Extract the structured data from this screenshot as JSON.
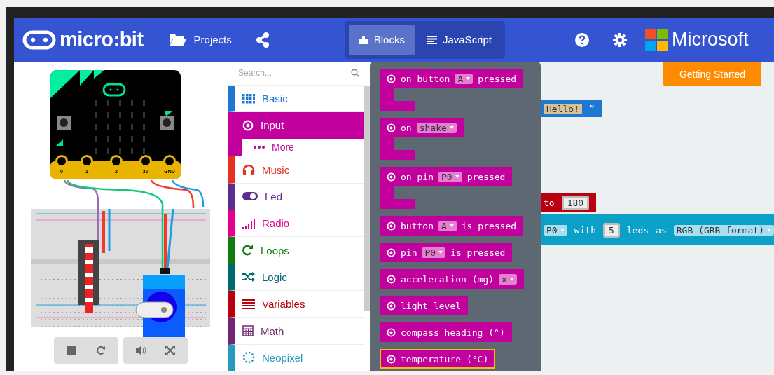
{
  "header": {
    "logo": "micro:bit",
    "projects": "Projects",
    "editor_tabs": [
      {
        "label": "Blocks",
        "selected": true
      },
      {
        "label": "JavaScript",
        "selected": false
      }
    ],
    "brand": "Microsoft"
  },
  "simulator": {
    "pin_labels": [
      "0",
      "1",
      "2",
      "3V",
      "GND"
    ]
  },
  "toolbox": {
    "search": {
      "placeholder": "Search..."
    },
    "categories": [
      {
        "label": "Basic",
        "kind": "category",
        "color": "#1e78d2",
        "selected": false
      },
      {
        "label": "Input",
        "kind": "category",
        "color": "#c2009e",
        "selected": true
      },
      {
        "label": "More",
        "kind": "more",
        "color": "#c2009e",
        "selected": false
      },
      {
        "label": "Music",
        "kind": "category",
        "color": "#e63022",
        "selected": false
      },
      {
        "label": "Led",
        "kind": "category",
        "color": "#5c2d91",
        "selected": false
      },
      {
        "label": "Radio",
        "kind": "category",
        "color": "#e3008c",
        "selected": false
      },
      {
        "label": "Loops",
        "kind": "category",
        "color": "#107c10",
        "selected": false
      },
      {
        "label": "Logic",
        "kind": "category",
        "color": "#006970",
        "selected": false
      },
      {
        "label": "Variables",
        "kind": "category",
        "color": "#b8000e",
        "selected": false
      },
      {
        "label": "Math",
        "kind": "category",
        "color": "#712672",
        "selected": false
      },
      {
        "label": "Neopixel",
        "kind": "category",
        "color": "#2699bf",
        "selected": false
      }
    ]
  },
  "flyout": {
    "blocks": [
      {
        "kind": "event",
        "selected": false,
        "parts": [
          {
            "kind": "text",
            "text": "on button"
          },
          {
            "kind": "dropdown",
            "text": "A"
          },
          {
            "kind": "text",
            "text": "pressed"
          }
        ]
      },
      {
        "kind": "event",
        "selected": false,
        "parts": [
          {
            "kind": "text",
            "text": "on"
          },
          {
            "kind": "dropdown",
            "text": "shake"
          }
        ]
      },
      {
        "kind": "event",
        "selected": false,
        "parts": [
          {
            "kind": "text",
            "text": "on pin"
          },
          {
            "kind": "dropdown",
            "text": "P0"
          },
          {
            "kind": "text",
            "text": "pressed"
          }
        ]
      },
      {
        "kind": "reporter",
        "selected": false,
        "parts": [
          {
            "kind": "text",
            "text": "button"
          },
          {
            "kind": "dropdown",
            "text": "A"
          },
          {
            "kind": "text",
            "text": "is pressed"
          }
        ]
      },
      {
        "kind": "reporter",
        "selected": false,
        "parts": [
          {
            "kind": "text",
            "text": "pin"
          },
          {
            "kind": "dropdown",
            "text": "P0"
          },
          {
            "kind": "text",
            "text": "is pressed"
          }
        ]
      },
      {
        "kind": "reporter",
        "selected": false,
        "parts": [
          {
            "kind": "text",
            "text": "acceleration (mg)"
          },
          {
            "kind": "dropdown",
            "text": "x"
          }
        ]
      },
      {
        "kind": "reporter",
        "selected": false,
        "parts": [
          {
            "kind": "text",
            "text": "light level"
          }
        ]
      },
      {
        "kind": "reporter",
        "selected": false,
        "parts": [
          {
            "kind": "text",
            "text": "compass heading (°)"
          }
        ]
      },
      {
        "kind": "reporter",
        "selected": true,
        "parts": [
          {
            "kind": "text",
            "text": "temperature (°C)"
          }
        ]
      }
    ]
  },
  "workspace": {
    "getting_started": "Getting Started",
    "blocks": [
      {
        "color": "#1e78d2",
        "parts": [
          {
            "kind": "string",
            "text": "Hello!"
          },
          {
            "kind": "text",
            "text": "”"
          }
        ]
      },
      {
        "color": "#b8000e",
        "parts": [
          {
            "kind": "text",
            "text": "to"
          },
          {
            "kind": "number",
            "text": "180"
          }
        ]
      },
      {
        "color": "#0aa0c8",
        "parts": [
          {
            "kind": "dropdown",
            "text": "P0"
          },
          {
            "kind": "text",
            "text": "with"
          },
          {
            "kind": "number",
            "text": "5"
          },
          {
            "kind": "text",
            "text": "leds"
          },
          {
            "kind": "text",
            "text": "as"
          },
          {
            "kind": "dropdown",
            "text": "RGB (GRB format)"
          }
        ]
      }
    ]
  }
}
